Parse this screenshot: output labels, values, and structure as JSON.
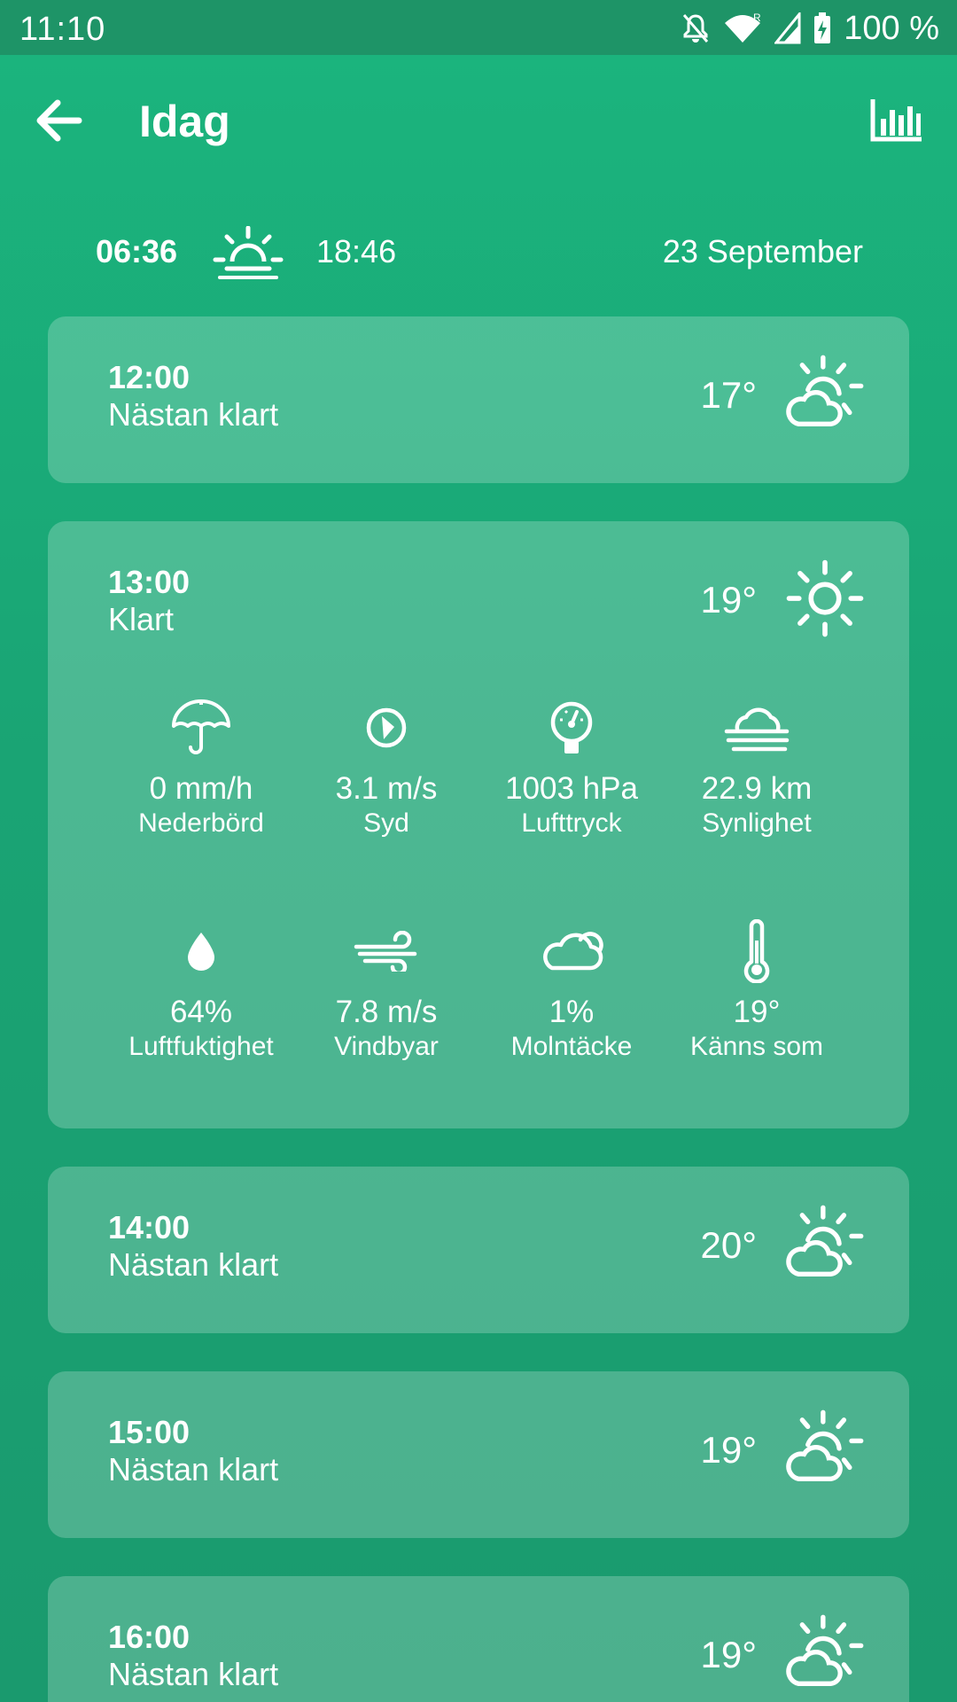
{
  "status": {
    "time": "11:10",
    "battery": "100 %"
  },
  "appbar": {
    "title": "Idag"
  },
  "sun": {
    "sunrise": "06:36",
    "sunset": "18:46",
    "date": "23 September"
  },
  "cards": [
    {
      "time": "12:00",
      "condition": "Nästan klart",
      "temp": "17°",
      "icon": "partly-sunny-icon"
    },
    {
      "time": "13:00",
      "condition": "Klart",
      "temp": "19°",
      "icon": "sun-icon",
      "details": [
        {
          "value": "0 mm/h",
          "label": "Nederbörd",
          "icon": "umbrella-icon"
        },
        {
          "value": "3.1 m/s",
          "label": "Syd",
          "icon": "compass-icon"
        },
        {
          "value": "1003 hPa",
          "label": "Lufttryck",
          "icon": "gauge-icon"
        },
        {
          "value": "22.9 km",
          "label": "Synlighet",
          "icon": "fog-icon"
        },
        {
          "value": "64%",
          "label": "Luftfuktighet",
          "icon": "drop-icon"
        },
        {
          "value": "7.8 m/s",
          "label": "Vindbyar",
          "icon": "wind-icon"
        },
        {
          "value": "1%",
          "label": "Molntäcke",
          "icon": "cloud-icon"
        },
        {
          "value": "19°",
          "label": "Känns som",
          "icon": "thermometer-icon"
        }
      ]
    },
    {
      "time": "14:00",
      "condition": "Nästan klart",
      "temp": "20°",
      "icon": "partly-sunny-icon"
    },
    {
      "time": "15:00",
      "condition": "Nästan klart",
      "temp": "19°",
      "icon": "partly-sunny-icon"
    },
    {
      "time": "16:00",
      "condition": "Nästan klart",
      "temp": "19°",
      "icon": "partly-sunny-icon"
    }
  ]
}
